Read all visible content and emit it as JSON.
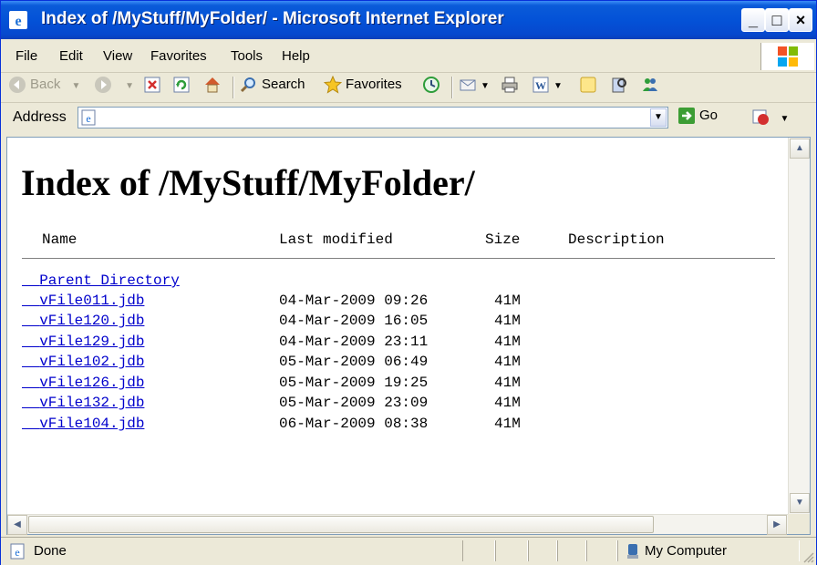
{
  "window": {
    "title": "Index of /MyStuff/MyFolder/ - Microsoft Internet Explorer",
    "controls": [
      "_",
      "□",
      "×"
    ]
  },
  "menu": {
    "items": [
      "File",
      "Edit",
      "View",
      "Favorites",
      "Tools",
      "Help"
    ]
  },
  "toolbar": {
    "back_label": "Back",
    "search_label": "Search",
    "favorites_label": "Favorites",
    "icons": [
      "back-icon",
      "forward-icon",
      "stop-icon",
      "refresh-icon",
      "home-icon",
      "search-icon",
      "favorites-icon",
      "history-icon",
      "mail-icon",
      "print-icon",
      "edit-icon",
      "discuss-icon",
      "messenger-icon"
    ]
  },
  "address": {
    "label": "Address",
    "value": "",
    "go_label": "Go"
  },
  "page": {
    "heading": "Index of /MyStuff/MyFolder/",
    "columns": {
      "name": "Name",
      "modified": "Last modified",
      "size": "Size",
      "description": "Description"
    },
    "parent_link": "Parent Directory",
    "files": [
      {
        "name": "vFile011.jdb",
        "modified": "04-Mar-2009 09:26",
        "size": "41M"
      },
      {
        "name": "vFile120.jdb",
        "modified": "04-Mar-2009 16:05",
        "size": "41M"
      },
      {
        "name": "vFile129.jdb",
        "modified": "04-Mar-2009 23:11",
        "size": "41M"
      },
      {
        "name": "vFile102.jdb",
        "modified": "05-Mar-2009 06:49",
        "size": "41M"
      },
      {
        "name": "vFile126.jdb",
        "modified": "05-Mar-2009 19:25",
        "size": "41M"
      },
      {
        "name": "vFile132.jdb",
        "modified": "05-Mar-2009 23:09",
        "size": "41M"
      },
      {
        "name": "vFile104.jdb",
        "modified": "06-Mar-2009 08:38",
        "size": "41M"
      }
    ]
  },
  "status": {
    "text": "Done",
    "zone": "My Computer"
  },
  "colors": {
    "titlebar": "#0452d7",
    "link": "#0000cc",
    "chrome": "#ece9d8"
  }
}
